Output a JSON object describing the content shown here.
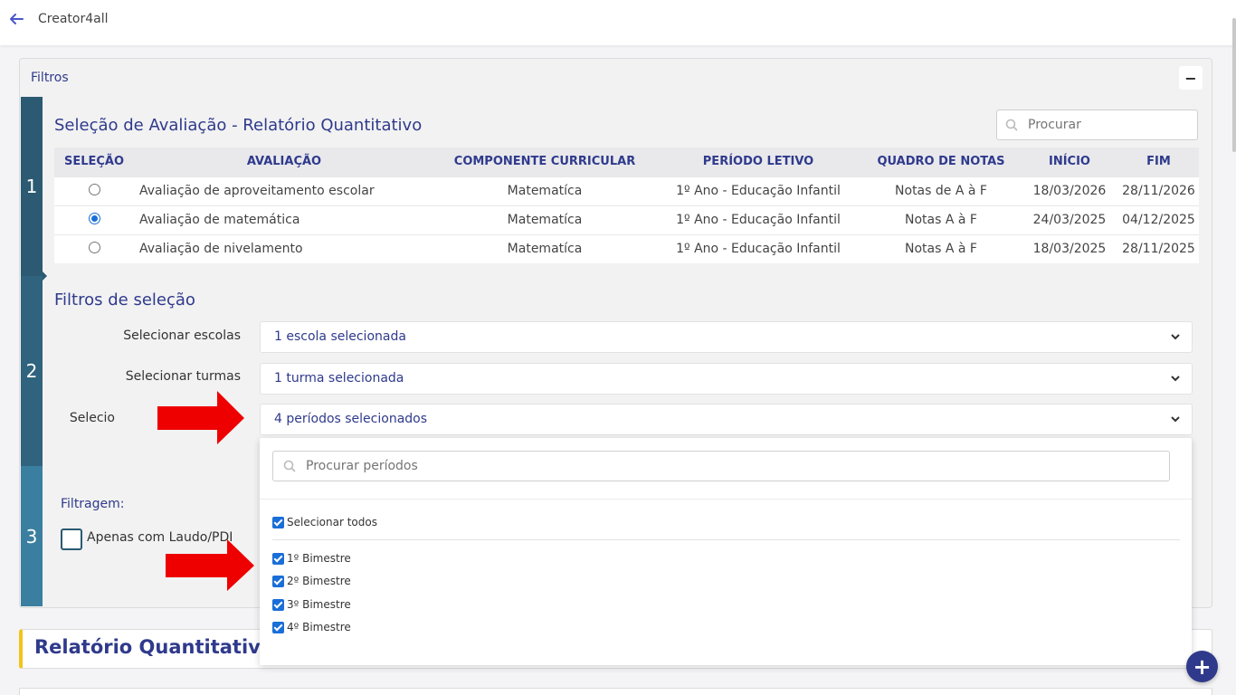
{
  "topbar": {
    "title": "Creator4all"
  },
  "filters": {
    "header": "Filtros",
    "collapse_label": "−",
    "steps": [
      "1",
      "2",
      "3"
    ],
    "section1": {
      "title": "Seleção de Avaliação - Relatório Quantitativo",
      "search_placeholder": "Procurar",
      "columns": [
        "SELEÇÃO",
        "AVALIAÇÃO",
        "COMPONENTE CURRICULAR",
        "PERÍODO LETIVO",
        "QUADRO DE NOTAS",
        "INÍCIO",
        "FIM"
      ],
      "rows": [
        {
          "selected": false,
          "avaliacao": "Avaliação de aproveitamento escolar",
          "componente": "Matematíca",
          "periodo": "1º Ano - Educação Infantil",
          "quadro": "Notas de A à F",
          "inicio": "18/03/2026",
          "fim": "28/11/2026"
        },
        {
          "selected": true,
          "avaliacao": "Avaliação de matemática",
          "componente": "Matematíca",
          "periodo": "1º Ano - Educação Infantil",
          "quadro": "Notas A à F",
          "inicio": "24/03/2025",
          "fim": "04/12/2025"
        },
        {
          "selected": false,
          "avaliacao": "Avaliação de nivelamento",
          "componente": "Matematíca",
          "periodo": "1º Ano - Educação Infantil",
          "quadro": "Notas A à F",
          "inicio": "18/03/2025",
          "fim": "28/11/2025"
        }
      ]
    },
    "section2": {
      "title": "Filtros de seleção",
      "escolas": {
        "label": "Selecionar escolas",
        "value": "1 escola selecionada"
      },
      "turmas": {
        "label": "Selecionar turmas",
        "value": "1 turma selecionada"
      },
      "periodos": {
        "label": "Selecio",
        "value": "4 períodos selecionados"
      }
    },
    "section3": {
      "label": "Filtragem:",
      "laudo_label": "Apenas com Laudo/PDI"
    }
  },
  "periodos_dropdown": {
    "search_placeholder": "Procurar períodos",
    "select_all_label": "Selecionar todos",
    "options": [
      "1º Bimestre",
      "2º Bimestre",
      "3º Bimestre",
      "4º Bimestre"
    ]
  },
  "report": {
    "title": "Relatório Quantitativo"
  },
  "fab_label": "+",
  "colors": {
    "accent": "#2f3a8c",
    "step_dark": "#2b5a72",
    "step_light": "#3b7fa0",
    "highlight_yellow": "#f2c518",
    "annotation_arrow": "#ee0000"
  }
}
